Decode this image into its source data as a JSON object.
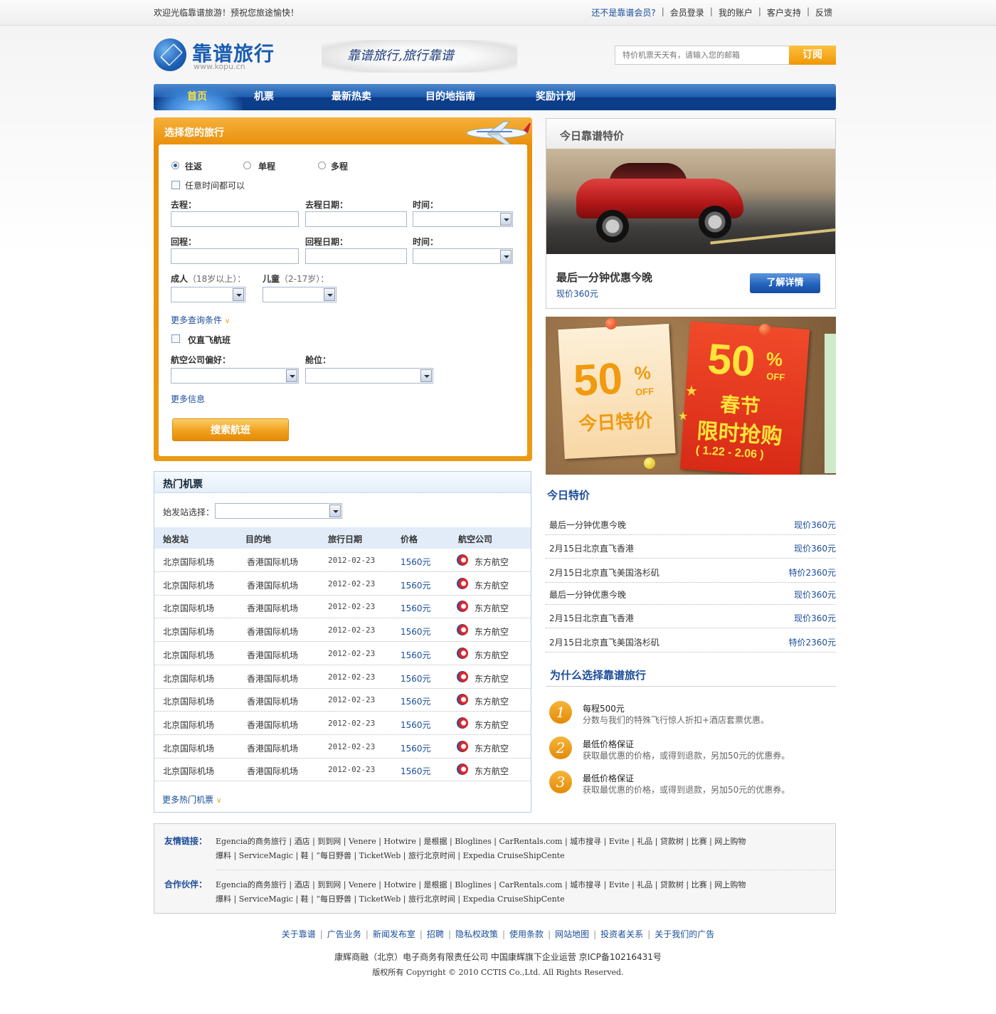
{
  "topbar": {
    "welcome": "欢迎光临靠谱旅游！预祝您旅途愉快！",
    "links": [
      "还不是靠谱会员?",
      "会员登录",
      "我的账户",
      "客户支持",
      "反馈"
    ]
  },
  "header": {
    "logo_text": "靠谱旅行",
    "logo_url": "www.kopu.cn",
    "slogan": "靠谱旅行,旅行靠谱",
    "subscribe_placeholder": "特价机票天天有，请输入您的邮箱",
    "subscribe_button": "订阅"
  },
  "nav": [
    "首页",
    "机票",
    "最新热卖",
    "目的地指南",
    "奖励计划"
  ],
  "search": {
    "title": "选择您的旅行",
    "trip_types": [
      "往返",
      "单程",
      "多程"
    ],
    "any_time": "任意时间都可以",
    "depart": "去程：",
    "depart_date": "去程日期：",
    "time1": "时间：",
    "return": "回程：",
    "return_date": "回程日期：",
    "time2": "时间：",
    "adult": "成人",
    "adult_sub": "（18岁以上）：",
    "child": "儿童",
    "child_sub": "（2-17岁）：",
    "more_conditions": "更多查询条件",
    "direct_only": "仅直飞航班",
    "airline_pref": "航空公司偏好：",
    "cabin": "舱位：",
    "more_info": "更多信息",
    "search_button": "搜索航班"
  },
  "hot": {
    "title": "热门机票",
    "origin_label": "始发站选择：",
    "headers": [
      "始发站",
      "目的地",
      "旅行日期",
      "价格",
      "航空公司"
    ],
    "rows": [
      [
        "北京国际机场",
        "香港国际机场",
        "2012-02-23",
        "1560元",
        "东方航空"
      ],
      [
        "北京国际机场",
        "香港国际机场",
        "2012-02-23",
        "1560元",
        "东方航空"
      ],
      [
        "北京国际机场",
        "香港国际机场",
        "2012-02-23",
        "1560元",
        "东方航空"
      ],
      [
        "北京国际机场",
        "香港国际机场",
        "2012-02-23",
        "1560元",
        "东方航空"
      ],
      [
        "北京国际机场",
        "香港国际机场",
        "2012-02-23",
        "1560元",
        "东方航空"
      ],
      [
        "北京国际机场",
        "香港国际机场",
        "2012-02-23",
        "1560元",
        "东方航空"
      ],
      [
        "北京国际机场",
        "香港国际机场",
        "2012-02-23",
        "1560元",
        "东方航空"
      ],
      [
        "北京国际机场",
        "香港国际机场",
        "2012-02-23",
        "1560元",
        "东方航空"
      ],
      [
        "北京国际机场",
        "香港国际机场",
        "2012-02-23",
        "1560元",
        "东方航空"
      ],
      [
        "北京国际机场",
        "香港国际机场",
        "2012-02-23",
        "1560元",
        "东方航空"
      ]
    ],
    "more": "更多热门机票"
  },
  "deal": {
    "title": "今日靠谱特价",
    "headline": "最后一分钟优惠今晚",
    "price": "现价360元",
    "button": "了解详情"
  },
  "promo": {
    "left_pct": "50",
    "left_off": "OFF",
    "left_text": "今日特价",
    "right_pct": "50",
    "right_off": "OFF",
    "right_text1": "春节",
    "right_text2": "限时抢购",
    "right_dates": "( 1.22 - 2.06 )"
  },
  "today": {
    "title": "今日特价",
    "items": [
      [
        "最后一分钟优惠今晚",
        "现价360元"
      ],
      [
        "2月15日北京直飞香港",
        "现价360元"
      ],
      [
        "2月15日北京直飞美国洛杉矶",
        "特价2360元"
      ],
      [
        "最后一分钟优惠今晚",
        "现价360元"
      ],
      [
        "2月15日北京直飞香港",
        "现价360元"
      ],
      [
        "2月15日北京直飞美国洛杉矶",
        "特价2360元"
      ]
    ]
  },
  "why": {
    "title": "为什么选择靠谱旅行",
    "items": [
      {
        "num": "1",
        "title": "每程500元",
        "desc": "分数与我们的特殊飞行惊人折扣+酒店套票优惠。"
      },
      {
        "num": "2",
        "title": "最低价格保证",
        "desc": "获取最优惠的价格，或得到退款，另加50元的优惠券。"
      },
      {
        "num": "3",
        "title": "最低价格保证",
        "desc": "获取最优惠的价格，或得到退款，另加50元的优惠券。"
      }
    ]
  },
  "links": {
    "friends_label": "友情链接：",
    "partners_label": "合作伙伴：",
    "line1": "Egencia的商务旅行 | 酒店 | 到到网 | Venere | Hotwire | 是根据 | Bloglines | CarRentals.com | 城市搜寻 | Evite | 礼品 | 贷款树 | 比赛 | 网上购物",
    "line2": "爆料 | ServiceMagic | 鞋 | “每日野兽 | TicketWeb | 旅行北京时间 | Expedia CruiseShipCente"
  },
  "footer": {
    "links": [
      "关于靠谱",
      "广告业务",
      "新闻发布室",
      "招聘",
      "隐私权政策",
      "使用条款",
      "网站地图",
      "投资者关系",
      "关于我们的广告"
    ],
    "company": "康辉商融（北京）电子商务有限责任公司 中国康辉旗下企业运营 京ICP备10216431号",
    "copyright": "版权所有 Copyright © 2010 CCTIS Co.,Ltd. All Rights Reserved."
  }
}
